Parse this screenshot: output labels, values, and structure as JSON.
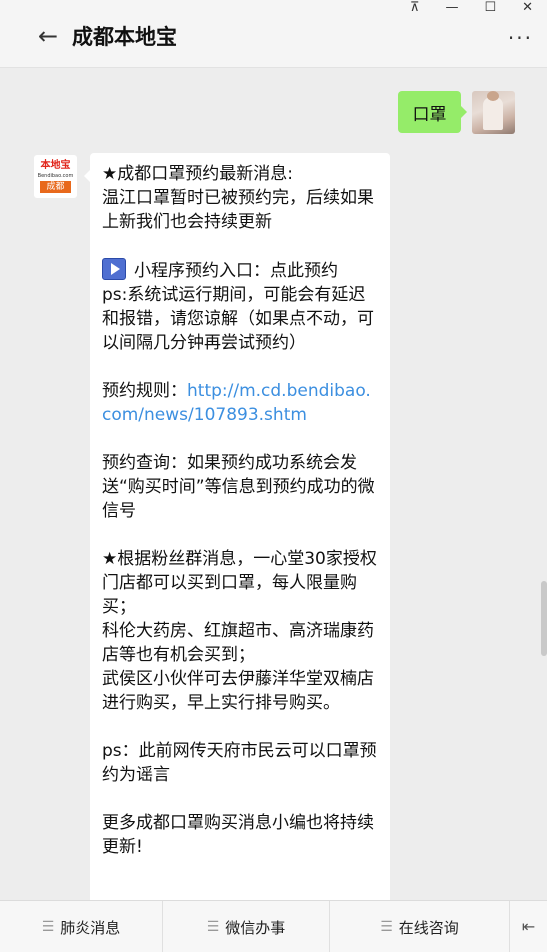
{
  "window": {
    "pin_icon": "pin-icon",
    "minimize_glyph": "—",
    "maximize_glyph": "☐",
    "close_glyph": "✕"
  },
  "header": {
    "back_glyph": "←",
    "title": "成都本地宝",
    "more_glyph": "···"
  },
  "sent_message": {
    "text": "口罩"
  },
  "bot_avatar": {
    "logo_text": "本地宝",
    "logo_domain": "Bendibao.com",
    "logo_city": "成都"
  },
  "received_message": {
    "line1": "★成都口罩预约最新消息:",
    "line2": "温江口罩暂时已被预约完，后续如果上新我们也会持续更新",
    "mini_program": "小程序预约入口：点此预约",
    "ps_note": "ps:系统试运行期间，可能会有延迟和报错，请您谅解（如果点不动，可以间隔几分钟再尝试预约）",
    "rules_label": "预约规则：",
    "rules_link": "http://m.cd.bendibao.com/news/107893.shtm",
    "query_text": "预约查询：如果预约成功系统会发送“购买时间”等信息到预约成功的微信号",
    "fans_line": "★根据粉丝群消息，一心堂30家授权门店都可以买到口罩，每人限量购买；",
    "pharmacy_line": "科伦大药房、红旗超市、高济瑞康药店等也有机会买到；",
    "wuhou_line": "武侯区小伙伴可去伊藤洋华堂双楠店进行购买，早上实行排号购买。",
    "rumor_line": "ps：此前网传天府市民云可以口罩预约为谣言",
    "more_line": "更多成都口罩购买消息小编也将持续更新!"
  },
  "bottom_menu": {
    "items": [
      {
        "label": "肺炎消息"
      },
      {
        "label": "微信办事"
      },
      {
        "label": "在线咨询"
      }
    ],
    "menu_glyph": "☰",
    "keyboard_glyph": "⇤"
  }
}
